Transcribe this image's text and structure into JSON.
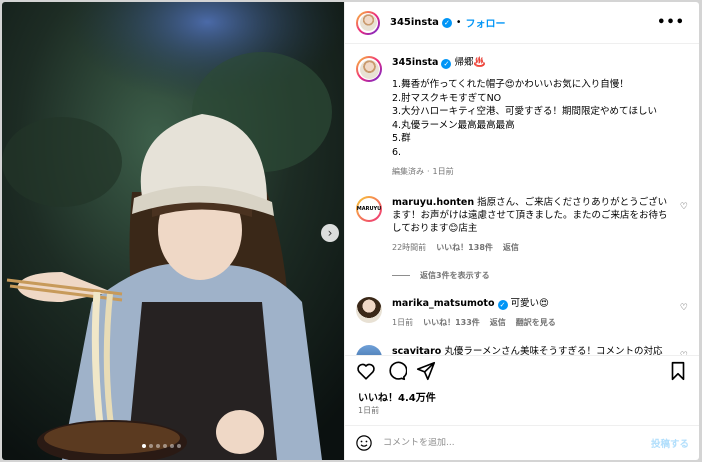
{
  "header": {
    "username": "345insta",
    "separator": "•",
    "follow_label": "フォロー",
    "more_label": "•••"
  },
  "caption": {
    "username": "345insta",
    "title": "帰郷♨️",
    "lines": [
      "1.舞香が作ってくれた帽子😍かわいいお気に入り自慢！",
      "2.肘マスクキモすぎてNO",
      "3.大分ハローキティ空港、可愛すぎる！期間限定やめてほしい",
      "4.丸優ラーメン最高最高最高",
      "5.群",
      "6."
    ],
    "meta_edited": "編集済み",
    "meta_dot": "·",
    "meta_time": "1日前"
  },
  "comments": [
    {
      "username": "maruyu.honten",
      "text": "指原さん、ご来店くださりありがとうございます！お声がけは遠慮させて頂きました。またのご来店をお待ちしております😊店主",
      "time": "22時間前",
      "likes": "いいね！138件",
      "reply": "返信",
      "view_replies": "返信3件を表示する"
    },
    {
      "username": "marika_matsumoto",
      "text": "可愛い😍",
      "time": "1日前",
      "likes": "いいね！133件",
      "reply": "返信",
      "translate": "翻訳を見る"
    },
    {
      "username": "scavitaro",
      "text": "丸優ラーメンさん美味そうすぎる！コメントの対応"
    }
  ],
  "likes_total": "いいね！4.4万件",
  "post_date": "1日前",
  "comment_box": {
    "placeholder": "コメントを追加...",
    "post_label": "投稿する"
  },
  "icons": {
    "like": "heart-icon",
    "comment": "comment-icon",
    "share": "send-icon",
    "save": "bookmark-icon",
    "emoji": "emoji-icon",
    "next": "chevron-right-icon"
  },
  "colors": {
    "accent": "#0095f6",
    "muted": "#737373",
    "post_disabled": "#b2dffc"
  },
  "carousel": {
    "slide_count": 6,
    "active_index": 0,
    "next_label": "›"
  }
}
